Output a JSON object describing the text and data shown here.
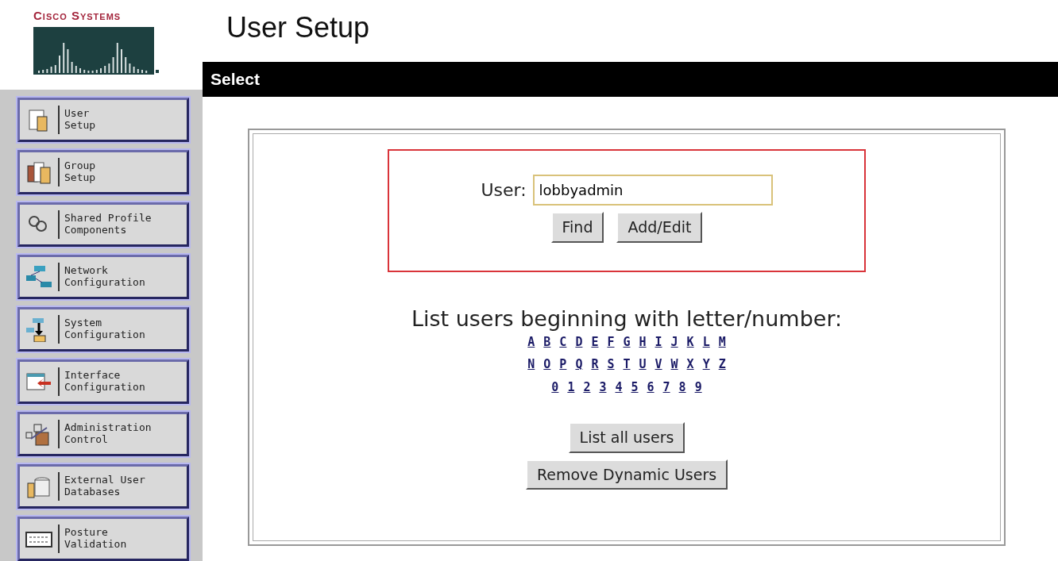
{
  "logo": {
    "text": "Cisco Systems"
  },
  "page_title": "User Setup",
  "section_header": "Select",
  "sidebar": {
    "items": [
      {
        "lines": [
          "User",
          "Setup"
        ]
      },
      {
        "lines": [
          "Group",
          "Setup"
        ]
      },
      {
        "lines": [
          "Shared Profile",
          "Components"
        ]
      },
      {
        "lines": [
          "Network",
          "Configuration"
        ]
      },
      {
        "lines": [
          "System",
          "Configuration"
        ]
      },
      {
        "lines": [
          "Interface",
          "Configuration"
        ]
      },
      {
        "lines": [
          "Administration",
          "Control"
        ]
      },
      {
        "lines": [
          "External User",
          "Databases"
        ]
      },
      {
        "lines": [
          "Posture",
          "Validation"
        ]
      }
    ]
  },
  "user_search": {
    "label": "User:",
    "value": "lobbyadmin",
    "buttons": [
      "Find",
      "Add/Edit"
    ]
  },
  "list_prompt": "List users beginning with letter/number:",
  "letter_rows": [
    [
      "A",
      "B",
      "C",
      "D",
      "E",
      "F",
      "G",
      "H",
      "I",
      "J",
      "K",
      "L",
      "M"
    ],
    [
      "N",
      "O",
      "P",
      "Q",
      "R",
      "S",
      "T",
      "U",
      "V",
      "W",
      "X",
      "Y",
      "Z"
    ],
    [
      "0",
      "1",
      "2",
      "3",
      "4",
      "5",
      "6",
      "7",
      "8",
      "9"
    ]
  ],
  "list_buttons": [
    "List all users",
    "Remove Dynamic Users"
  ]
}
